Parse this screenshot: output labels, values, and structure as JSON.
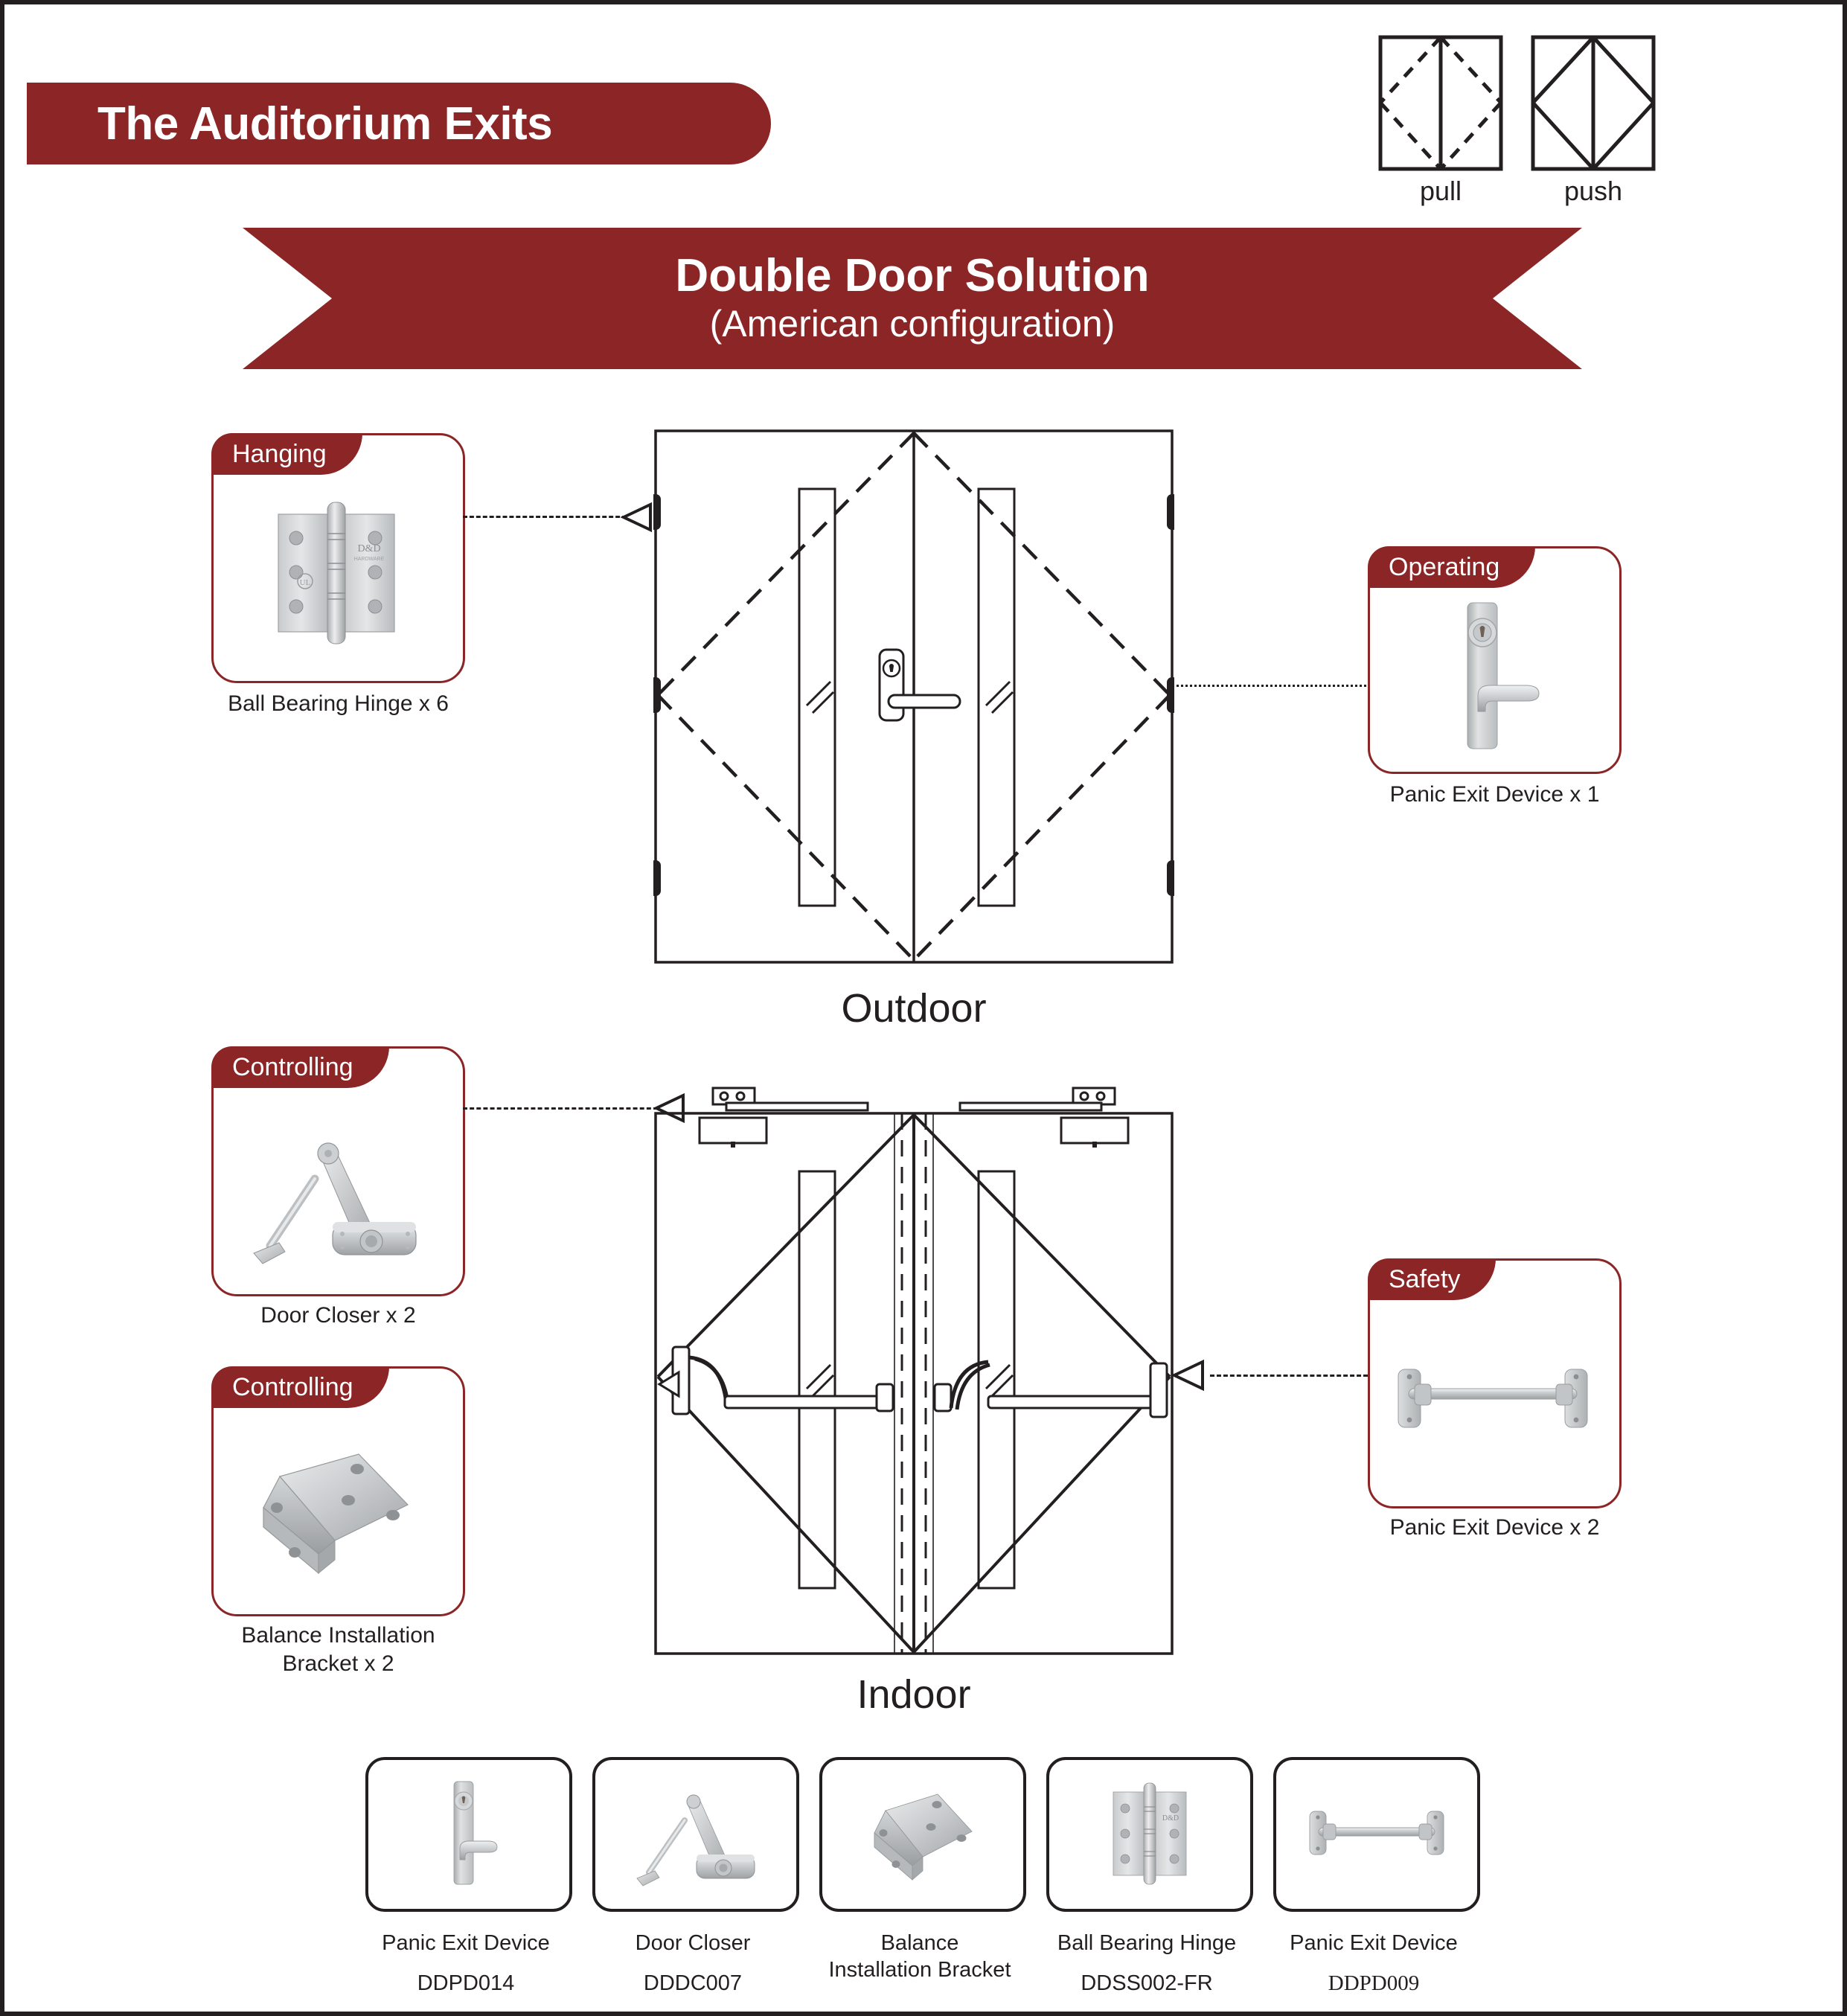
{
  "header": {
    "title": "The Auditorium Exits",
    "accent_color": "#8B2526",
    "line_color": "#231f20"
  },
  "legend": {
    "pull_label": "pull",
    "push_label": "push"
  },
  "banner": {
    "title": "Double Door Solution",
    "subtitle": "(American configuration)"
  },
  "sections": {
    "outdoor_label": "Outdoor",
    "indoor_label": "Indoor"
  },
  "callouts": [
    {
      "tag": "Hanging",
      "caption": "Ball Bearing Hinge x 6",
      "icon": "ball-bearing-hinge"
    },
    {
      "tag": "Operating",
      "caption": "Panic Exit Device x 1",
      "icon": "lever-trim-escutcheon"
    },
    {
      "tag": "Controlling",
      "caption": "Door Closer x 2",
      "icon": "door-closer"
    },
    {
      "tag": "Controlling",
      "caption": "Balance Installation Bracket x 2",
      "icon": "balance-bracket"
    },
    {
      "tag": "Safety",
      "caption": "Panic Exit Device x 2",
      "icon": "panic-push-bar"
    }
  ],
  "products": [
    {
      "name": "Panic Exit Device",
      "code": "DDPD014",
      "icon": "lever-trim-escutcheon"
    },
    {
      "name": "Door Closer",
      "code": "DDDC007",
      "icon": "door-closer"
    },
    {
      "name": "Balance\nInstallation Bracket",
      "name_line1": "Balance",
      "name_line2": "Installation Bracket",
      "code": "",
      "icon": "balance-bracket"
    },
    {
      "name": "Ball Bearing Hinge",
      "code": "DDSS002-FR",
      "icon": "ball-bearing-hinge"
    },
    {
      "name": "Panic Exit Device",
      "code": "DDPD009",
      "icon": "panic-push-bar"
    }
  ]
}
